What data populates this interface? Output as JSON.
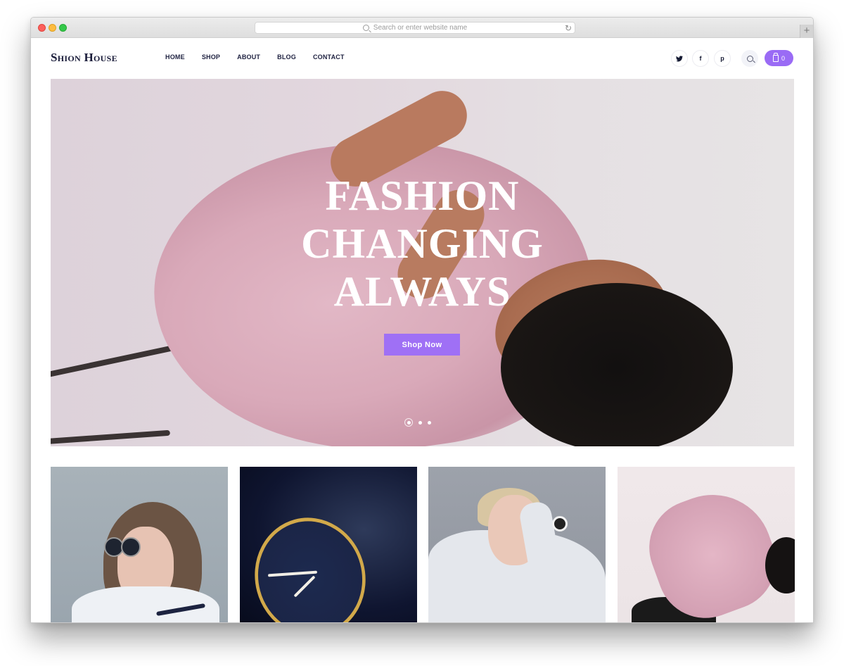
{
  "browser": {
    "url_placeholder": "Search or enter website name",
    "reload_icon": "↻",
    "new_tab_icon": "+"
  },
  "header": {
    "logo": "Shion House",
    "nav": [
      "HOME",
      "SHOP",
      "ABOUT",
      "BLOG",
      "CONTACT"
    ],
    "social": [
      {
        "name": "twitter",
        "glyph": "t"
      },
      {
        "name": "facebook",
        "glyph": "f"
      },
      {
        "name": "pinterest",
        "glyph": "p"
      }
    ],
    "cart_count": "0",
    "accent_color": "#9a6bf5"
  },
  "hero": {
    "title_lines": [
      "FASHION",
      "CHANGING",
      "ALWAYS"
    ],
    "cta_label": "Shop Now",
    "slides_total": 3,
    "active_slide": 1
  },
  "gallery": {
    "tiles": [
      {
        "subject": "woman-with-round-sunglasses"
      },
      {
        "subject": "gold-wrist-watch"
      },
      {
        "subject": "blonde-woman-with-smartwatch"
      },
      {
        "subject": "woman-in-pink-satin-shirt"
      }
    ]
  }
}
